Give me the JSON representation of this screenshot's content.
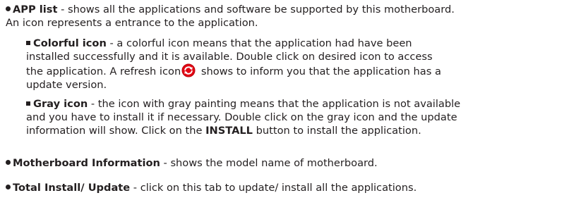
{
  "app_list": {
    "title": "APP list",
    "line1": " - shows all the applications and software be supported by this motherboard.",
    "line2": "An icon represents a entrance to the application."
  },
  "colorful_icon": {
    "title": "Colorful icon",
    "line1": " - a colorful icon means that the application had have been",
    "line2": "installed successfully and it is available. Double click on desired icon to access",
    "line3_before_icon": "the application.  A refresh icon",
    "line3_after_icon": " shows to inform you that the application has a",
    "line4": "update version.",
    "icon_name": "refresh-icon",
    "icon_color": "#e30613"
  },
  "gray_icon": {
    "title": "Gray icon",
    "line1": " - the icon with gray painting means that the application is not available",
    "line2": "and you have to install it if necessary. Double click on the gray icon and the update",
    "line3_before": "information will show. Click on the ",
    "install_label": "INSTALL",
    "line3_after": " button to install the application."
  },
  "motherboard_info": {
    "title": "Motherboard Information",
    "text": " - shows the model name of motherboard."
  },
  "total_install": {
    "title": "Total Install/ Update",
    "text": " - click on this tab to update/ install all the applications."
  }
}
